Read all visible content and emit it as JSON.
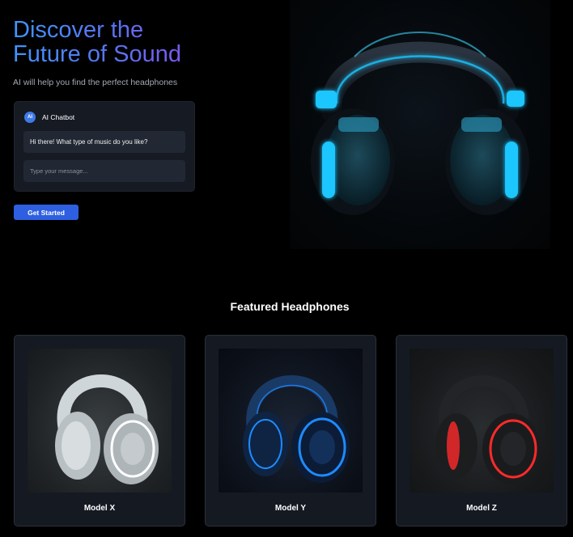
{
  "hero": {
    "title_line1": "Discover the",
    "title_line2": "Future of Sound",
    "subtitle": "AI will help you find the perfect headphones"
  },
  "chatbot": {
    "avatar_text": "AI",
    "title": "AI Chatbot",
    "bot_message": "Hi there! What type of music do you like?",
    "input_placeholder": "Type your message...",
    "input_value": ""
  },
  "cta": {
    "label": "Get Started"
  },
  "featured": {
    "heading": "Featured Headphones",
    "products": [
      {
        "name": "Model X",
        "icon": "headphones-white-icon",
        "accent": "#e6eef5"
      },
      {
        "name": "Model Y",
        "icon": "headphones-blue-icon",
        "accent": "#1e8bff"
      },
      {
        "name": "Model Z",
        "icon": "headphones-red-icon",
        "accent": "#ff2a2a"
      }
    ]
  },
  "colors": {
    "background": "#000000",
    "card": "#151922",
    "primary_button": "#2d5fe0",
    "hero_glow": "#1fc6ff"
  }
}
